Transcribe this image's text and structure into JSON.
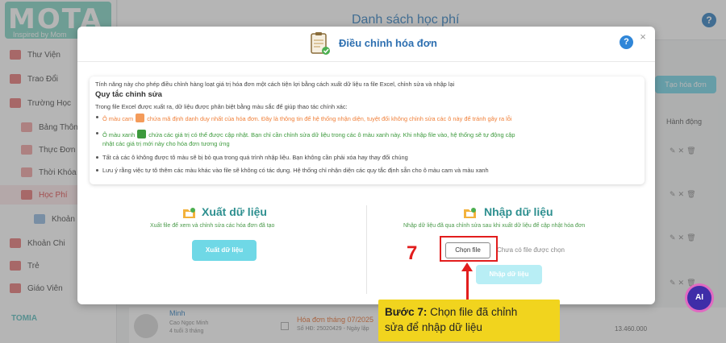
{
  "app": {
    "logo": "MOTA",
    "logo_tagline": "Inspired by Mom",
    "page_title": "Danh sách học phí",
    "brand_footer": "TOMIA",
    "create_button": "Tạo hóa đơn",
    "action_column": "Hành động"
  },
  "sidebar": {
    "items": [
      {
        "label": "Thư Viện"
      },
      {
        "label": "Trao Đổi"
      },
      {
        "label": "Trường Học"
      },
      {
        "label": "Bảng Thông"
      },
      {
        "label": "Thực Đơn"
      },
      {
        "label": "Thời Khóa Biểu"
      },
      {
        "label": "Học Phí"
      },
      {
        "label": "Khoản"
      },
      {
        "label": "Khoản Chi"
      },
      {
        "label": "Trẻ"
      },
      {
        "label": "Giáo Viên"
      }
    ]
  },
  "background_row": {
    "name": "Minh",
    "sub1": "Cao Ngọc Minh",
    "sub2": "4 tuổi 3 tháng",
    "invoice_title": "Hóa đơn tháng 07/2025",
    "invoice_code": "Số HĐ: 25020429 - Ngày lập",
    "amount": "13.460.000"
  },
  "modal": {
    "title": "Điều chỉnh hóa đơn",
    "help_label": "?",
    "close_label": "×",
    "intro": "Tính năng này cho phép điều chỉnh hàng loạt giá trị hóa đơn một cách tiện lợi bằng cách xuất dữ liệu ra file Excel, chỉnh sửa và nhập lại",
    "rules_title": "Quy tắc chỉnh sửa",
    "rules_intro": "Trong file Excel được xuất ra, dữ liệu được phân biệt bằng màu sắc để giúp thao tác chính xác:",
    "rule_orange_a": "Ô màu cam",
    "rule_orange_b": "chứa mã định danh duy nhất của hóa đơn. Đây là thông tin để hệ thống nhận diện, tuyệt đối không chỉnh sửa các ô này để tránh gây ra lỗi",
    "rule_green_a": "Ô màu xanh",
    "rule_green_b": "chứa các giá trị có thể được cập nhật. Bạn chỉ cần chỉnh sửa dữ liệu trong các ô màu xanh này. Khi nhập file vào, hệ thống sẽ tự động cập",
    "rule_green_c": "nhật các giá trị mới này cho hóa đơn tương ứng",
    "rule_other": "Tất cả các ô không được tô màu sẽ bị bỏ qua trong quá trình nhập liệu. Bạn không cần phải xóa hay thay đổi chúng",
    "rule_note": "Lưu ý rằng việc tự tô thêm các màu khác vào file sẽ không có tác dụng. Hệ thống chỉ nhận diện các quy tắc định sẵn cho ô màu cam và màu xanh",
    "export": {
      "title": "Xuất dữ liệu",
      "desc": "Xuất file để xem và chỉnh sửa các hóa đơn đã tạo",
      "button": "Xuất dữ liệu"
    },
    "import": {
      "title": "Nhập dữ liệu",
      "desc": "Nhập dữ liệu đã qua chỉnh sửa sau khi xuất dữ liệu để cập nhật hóa đơn",
      "choose_file": "Chọn file",
      "file_status": "Chưa có file được chọn",
      "button": "Nhập dữ liệu"
    }
  },
  "annotation": {
    "step_number": "7",
    "step_label": "Bước 7:",
    "step_text_1": "Chọn file đã chỉnh",
    "step_text_2": "sửa để nhập dữ liệu"
  },
  "ai_badge": "AI",
  "colors": {
    "accent": "#2d8f8f",
    "orange_cell": "#f49b5a",
    "green_cell": "#3d9a3d",
    "annotation_red": "#e21d1d",
    "callout_yellow": "#f1d41e"
  }
}
